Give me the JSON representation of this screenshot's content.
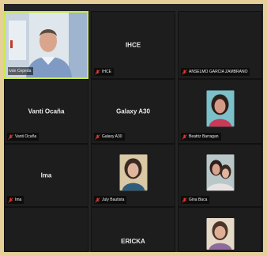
{
  "participants": [
    {
      "name": "Iván Cepeda",
      "center_text": "",
      "speaking": true,
      "type": "video"
    },
    {
      "name": "IHCE",
      "center_text": "IHCE",
      "type": "text"
    },
    {
      "name": "ANSELMO GARCIA ZAMBRANO",
      "center_text": "",
      "type": "text"
    },
    {
      "name": "Vanti Ocaña",
      "center_text": "Vanti Ocaña",
      "type": "text"
    },
    {
      "name": "Galaxy A30",
      "center_text": "Galaxy A30",
      "type": "text"
    },
    {
      "name": "Beatriz Barragan",
      "center_text": "",
      "type": "photo"
    },
    {
      "name": "Ima",
      "center_text": "Ima",
      "type": "text"
    },
    {
      "name": "July Bautista",
      "center_text": "",
      "type": "photo"
    },
    {
      "name": "Gina Baca",
      "center_text": "",
      "type": "photo"
    },
    {
      "name": "",
      "center_text": "",
      "type": "text"
    },
    {
      "name": "",
      "center_text": "ERICKA",
      "type": "text"
    },
    {
      "name": "",
      "center_text": "",
      "type": "photo"
    }
  ],
  "colors": {
    "speaker_border": "#c9e94a",
    "muted_icon": "#e03a2f",
    "frame": "#e6cf98"
  },
  "icons": {
    "muted": "mic-muted-icon"
  }
}
